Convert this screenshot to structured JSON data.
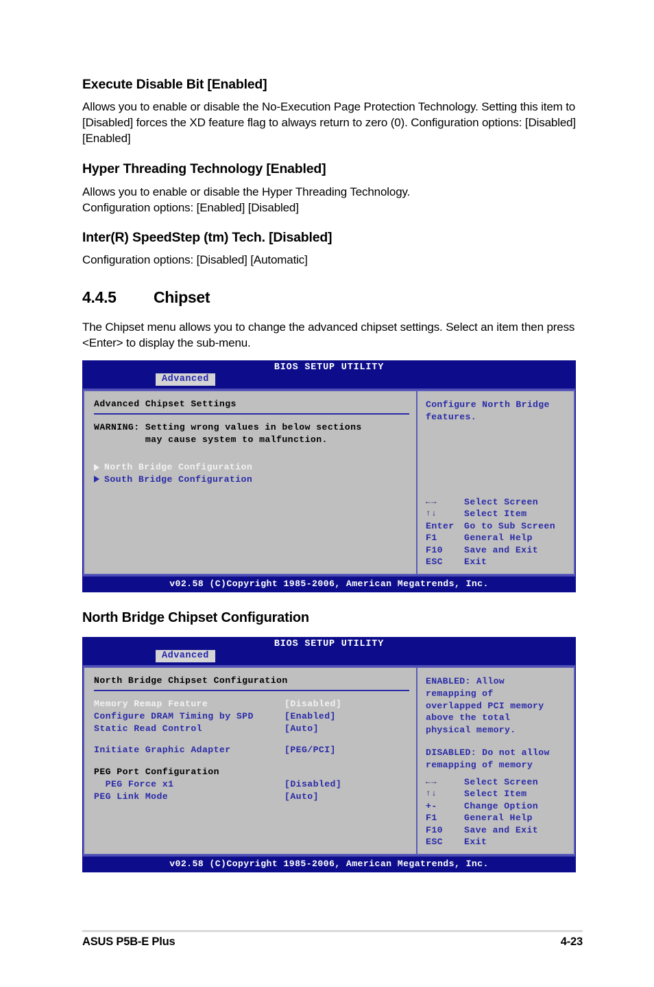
{
  "doc": {
    "items": [
      {
        "title": "Execute Disable Bit [Enabled]",
        "body": "Allows you to enable or disable the No-Execution Page Protection Technology. Setting this item to [Disabled] forces the XD feature flag to always return to zero (0). Configuration options: [Disabled] [Enabled]"
      },
      {
        "title": "Hyper Threading Technology [Enabled]",
        "body": "Allows you to enable or disable the Hyper Threading Technology.\nConfiguration options: [Enabled] [Disabled]"
      },
      {
        "title": "Inter(R) SpeedStep (tm) Tech. [Disabled]",
        "body": "Configuration options: [Disabled] [Automatic]"
      }
    ],
    "section": {
      "number": "4.4.5",
      "name": "Chipset",
      "body": "The Chipset menu allows you to change the advanced chipset settings. Select an item then press <Enter> to display the sub-menu."
    },
    "subhead": "North Bridge Chipset Configuration"
  },
  "bios1": {
    "title": "BIOS SETUP UTILITY",
    "tab": "Advanced",
    "panel_title": "Advanced Chipset Settings",
    "warning_lines": [
      "WARNING: Setting wrong values in below sections",
      "         may cause system to malfunction."
    ],
    "menu": [
      {
        "label": "North Bridge Configuration",
        "selected": true
      },
      {
        "label": "South Bridge Configuration",
        "selected": false
      }
    ],
    "help": "Configure North Bridge\nfeatures.",
    "legend": [
      {
        "key": "←→",
        "glyph": true,
        "action": "Select Screen"
      },
      {
        "key": "↑↓",
        "glyph": true,
        "action": "Select Item"
      },
      {
        "key": "Enter",
        "glyph": false,
        "action": "Go to Sub Screen"
      },
      {
        "key": "F1",
        "glyph": false,
        "action": "General Help"
      },
      {
        "key": "F10",
        "glyph": false,
        "action": "Save and Exit"
      },
      {
        "key": "ESC",
        "glyph": false,
        "action": "Exit"
      }
    ],
    "footer": "v02.58 (C)Copyright 1985-2006, American Megatrends, Inc."
  },
  "bios2": {
    "title": "BIOS SETUP UTILITY",
    "tab": "Advanced",
    "panel_title": "North Bridge Chipset Configuration",
    "settings": [
      {
        "name": "Memory Remap Feature",
        "value": "[Disabled]",
        "selected": true,
        "header": false
      },
      {
        "name": "Configure DRAM Timing by SPD",
        "value": "[Enabled]",
        "selected": false,
        "header": false
      },
      {
        "name": "Static Read Control",
        "value": "[Auto]",
        "selected": false,
        "header": false
      }
    ],
    "settings2": [
      {
        "name": "Initiate Graphic Adapter",
        "value": "[PEG/PCI]",
        "selected": false,
        "header": false
      }
    ],
    "settings3": [
      {
        "name": "PEG Port Configuration",
        "value": "",
        "selected": false,
        "header": true
      },
      {
        "name": "  PEG Force x1",
        "value": "[Disabled]",
        "selected": false,
        "header": false
      },
      {
        "name": "PEG Link Mode",
        "value": "[Auto]",
        "selected": false,
        "header": false
      }
    ],
    "help_a": "ENABLED: Allow\nremapping of\noverlapped PCI memory\nabove the total\nphysical memory.",
    "help_b": "DISABLED: Do not allow\nremapping of memory",
    "legend": [
      {
        "key": "←→",
        "glyph": true,
        "action": "Select Screen"
      },
      {
        "key": "↑↓",
        "glyph": true,
        "action": "Select Item"
      },
      {
        "key": "+-",
        "glyph": false,
        "action": "Change Option"
      },
      {
        "key": "F1",
        "glyph": false,
        "action": "General Help"
      },
      {
        "key": "F10",
        "glyph": false,
        "action": "Save and Exit"
      },
      {
        "key": "ESC",
        "glyph": false,
        "action": "Exit"
      }
    ],
    "footer": "v02.58 (C)Copyright 1985-2006, American Megatrends, Inc."
  },
  "footer": {
    "left": "ASUS P5B-E Plus",
    "right": "4-23"
  },
  "colors": {
    "bios_header": "#0d0d8c",
    "bios_panel": "#bfbfbf",
    "bios_blue_text": "#2a2aa8",
    "bios_selected_text": "#f2f2f2"
  }
}
